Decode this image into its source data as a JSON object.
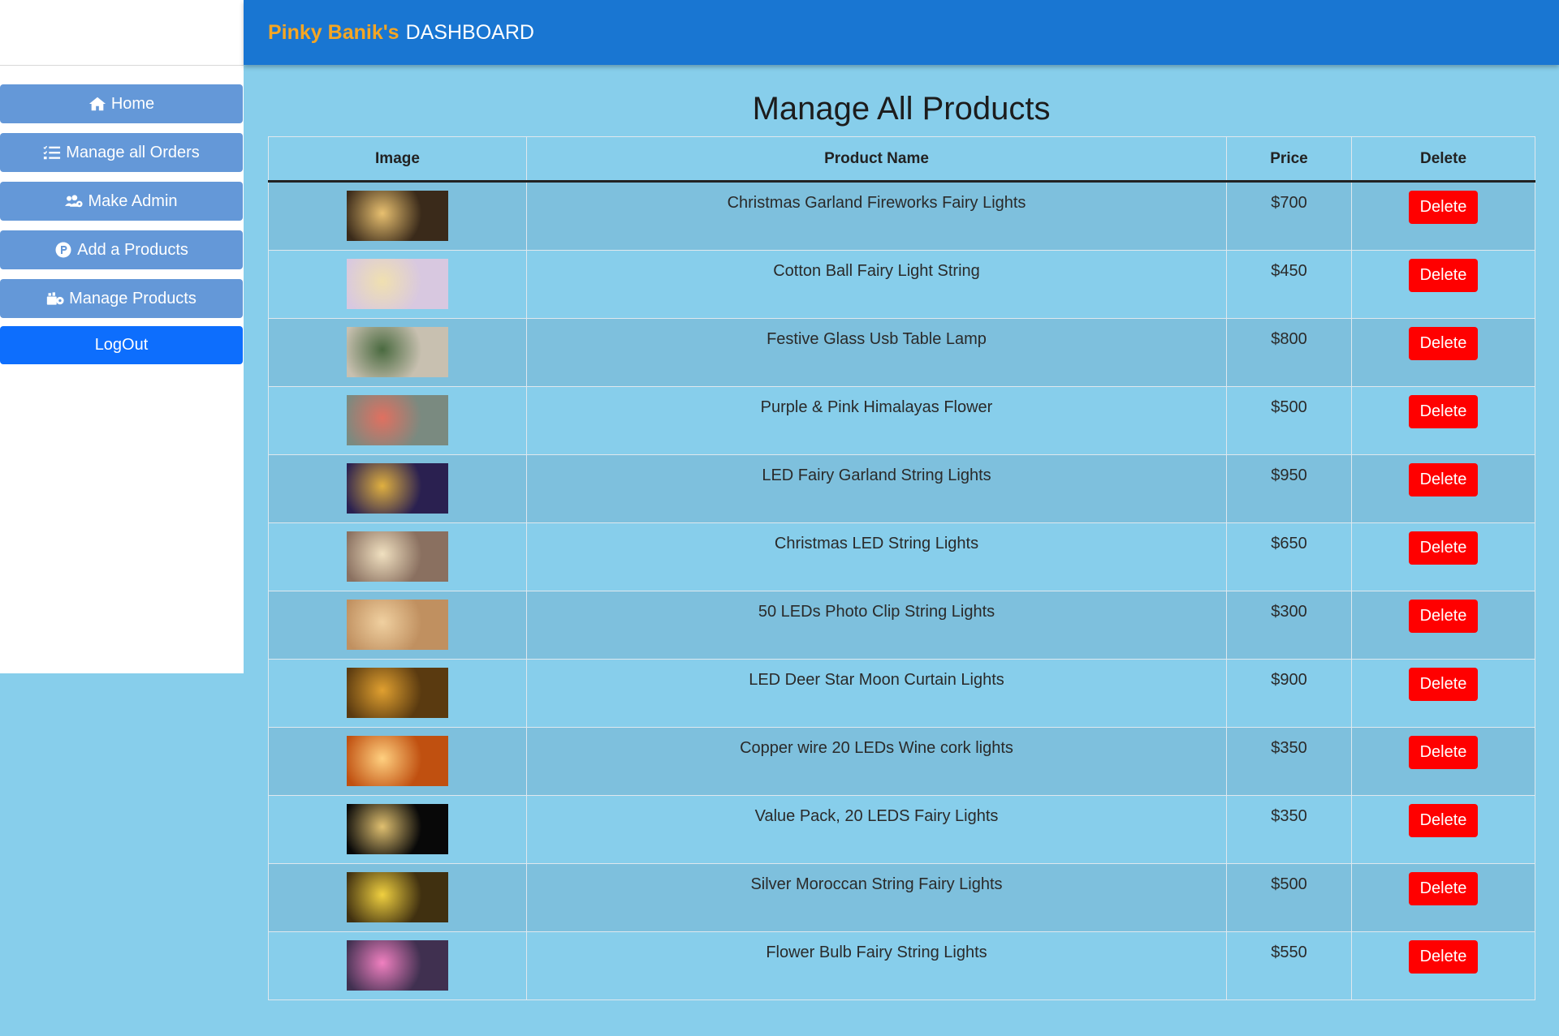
{
  "header": {
    "owner": "Pinky Banik's",
    "title": "DASHBOARD",
    "color": "#1976d2",
    "owner_color": "#f5a623"
  },
  "sidebar": {
    "items": [
      {
        "label": "Home",
        "icon": "home-icon"
      },
      {
        "label": "Manage all Orders",
        "icon": "list-check-icon"
      },
      {
        "label": "Make Admin",
        "icon": "users-cog-icon"
      },
      {
        "label": "Add a Products",
        "icon": "product-hunt-icon"
      },
      {
        "label": "Manage Products",
        "icon": "boxes-icon"
      },
      {
        "label": "LogOut",
        "icon": ""
      }
    ]
  },
  "main": {
    "title": "Manage All Products",
    "columns": [
      "Image",
      "Product Name",
      "Price",
      "Delete"
    ],
    "rows": [
      {
        "name": "Christmas Garland Fireworks Fairy Lights",
        "price": "$700",
        "delete_label": "Delete",
        "thumb": [
          "#3a2a1a",
          "#e8c070",
          "#8a3a20"
        ]
      },
      {
        "name": "Cotton Ball Fairy Light String",
        "price": "$450",
        "delete_label": "Delete",
        "thumb": [
          "#d8c8e0",
          "#f0e0b0",
          "#a090b8"
        ]
      },
      {
        "name": "Festive Glass Usb Table Lamp",
        "price": "$800",
        "delete_label": "Delete",
        "thumb": [
          "#c8c0b0",
          "#4a6a40",
          "#e8d8a0"
        ]
      },
      {
        "name": "Purple & Pink Himalayas Flower",
        "price": "$500",
        "delete_label": "Delete",
        "thumb": [
          "#7a8a80",
          "#e07060",
          "#a04040"
        ]
      },
      {
        "name": "LED Fairy Garland String Lights",
        "price": "$950",
        "delete_label": "Delete",
        "thumb": [
          "#2a2050",
          "#e0b040",
          "#6050a0"
        ]
      },
      {
        "name": "Christmas LED String Lights",
        "price": "$650",
        "delete_label": "Delete",
        "thumb": [
          "#8a7060",
          "#f0e0c0",
          "#403020"
        ]
      },
      {
        "name": "50 LEDs Photo Clip String Lights",
        "price": "$300",
        "delete_label": "Delete",
        "thumb": [
          "#c09060",
          "#f0d0a0",
          "#604030"
        ]
      },
      {
        "name": "LED Deer Star Moon Curtain Lights",
        "price": "$900",
        "delete_label": "Delete",
        "thumb": [
          "#5a3a10",
          "#e0a030",
          "#8a6020"
        ]
      },
      {
        "name": "Copper wire 20 LEDs Wine cork lights",
        "price": "$350",
        "delete_label": "Delete",
        "thumb": [
          "#c05010",
          "#ffd080",
          "#602010"
        ]
      },
      {
        "name": "Value Pack, 20 LEDS Fairy Lights",
        "price": "$350",
        "delete_label": "Delete",
        "thumb": [
          "#080808",
          "#e0c070",
          "#302010"
        ]
      },
      {
        "name": "Silver Moroccan String Fairy Lights",
        "price": "$500",
        "delete_label": "Delete",
        "thumb": [
          "#403010",
          "#f0d040",
          "#806010"
        ]
      },
      {
        "name": "Flower Bulb Fairy String Lights",
        "price": "$550",
        "delete_label": "Delete",
        "thumb": [
          "#403050",
          "#f080c0",
          "#60a060"
        ]
      }
    ]
  }
}
